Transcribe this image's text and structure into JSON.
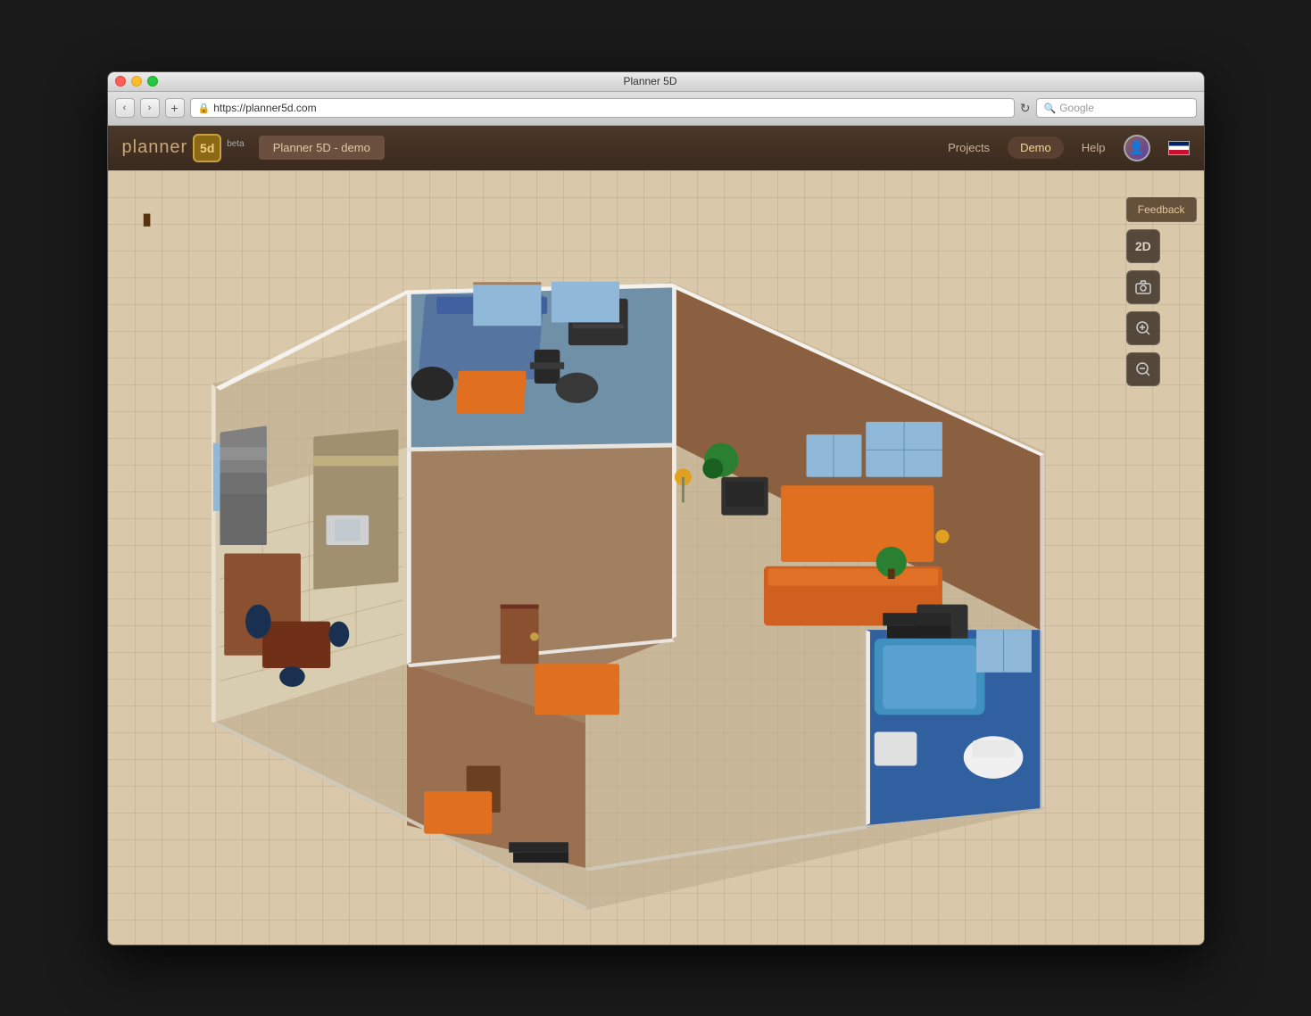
{
  "window": {
    "title": "Planner 5D",
    "traffic_lights": [
      "close",
      "minimize",
      "maximize"
    ]
  },
  "browser": {
    "back_label": "‹",
    "forward_label": "›",
    "add_tab_label": "+",
    "address": "https://planner5d.com",
    "search_placeholder": "Google",
    "refresh_label": "↻"
  },
  "header": {
    "logo_text": "planner",
    "logo_5d": "5d",
    "beta_label": "beta",
    "project_name": "Planner 5D - demo",
    "nav": {
      "projects_label": "Projects",
      "demo_label": "Demo",
      "help_label": "Help"
    },
    "flag": "uk"
  },
  "toolbar": {
    "feedback_label": "Feedback",
    "btn_2d_label": "2D",
    "btn_camera_label": "📷",
    "btn_zoom_in_label": "⊕",
    "btn_zoom_out_label": "⊖"
  },
  "canvas": {
    "background_color": "#d9c9aa",
    "grid_color": "#c4b090"
  }
}
